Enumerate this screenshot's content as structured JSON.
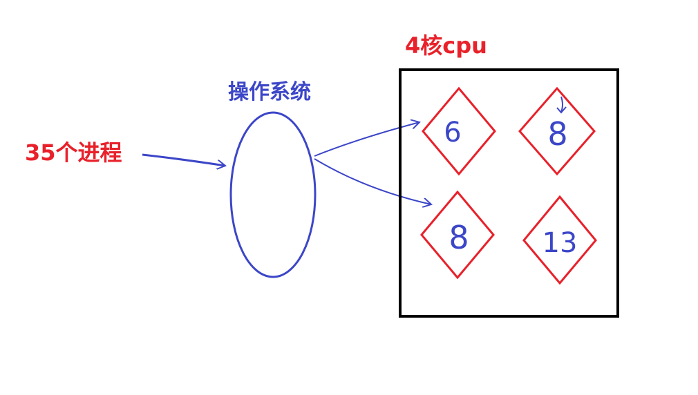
{
  "colors": {
    "red": "#e8212a",
    "blue": "#3c46c8",
    "black": "#000000",
    "background": "#ffffff"
  },
  "labels": {
    "processes": "35个进程",
    "os": "操作系统",
    "cpu": "4核cpu"
  },
  "cores": [
    {
      "value": "6"
    },
    {
      "value": "8"
    },
    {
      "value": "8"
    },
    {
      "value": "13"
    }
  ]
}
